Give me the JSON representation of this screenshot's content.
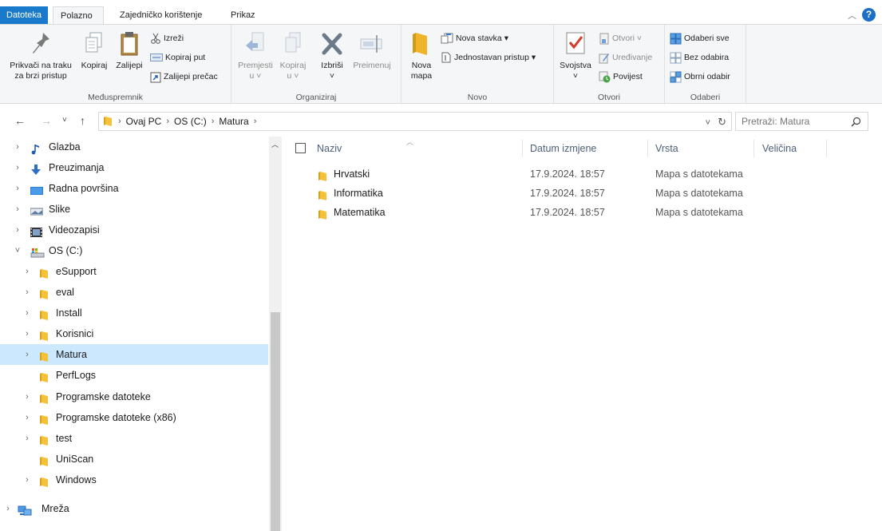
{
  "tabs": {
    "file": "Datoteka",
    "home": "Polazno",
    "share": "Zajedničko korištenje",
    "view": "Prikaz"
  },
  "ribbon": {
    "clipboard": {
      "label": "Međuspremnik",
      "pin_line1": "Prikvači na traku",
      "pin_line2": "za brzi pristup",
      "copy": "Kopiraj",
      "paste": "Zalijepi",
      "cut": "Izreži",
      "copy_path": "Kopiraj put",
      "paste_shortcut": "Zalijepi prečac"
    },
    "organize": {
      "label": "Organiziraj",
      "move_line1": "Premjesti",
      "move_line2": "u",
      "copy_line1": "Kopiraj",
      "copy_line2": "u",
      "delete": "Izbriši",
      "rename": "Preimenuj"
    },
    "new": {
      "label": "Novo",
      "new_folder_line1": "Nova",
      "new_folder_line2": "mapa",
      "new_item": "Nova stavka",
      "easy_access": "Jednostavan pristup"
    },
    "open": {
      "label": "Otvori",
      "properties": "Svojstva",
      "open": "Otvori",
      "edit": "Uređivanje",
      "history": "Povijest"
    },
    "select": {
      "label": "Odaberi",
      "select_all": "Odaberi sve",
      "select_none": "Bez odabira",
      "invert": "Obrni odabir"
    }
  },
  "address": {
    "crumbs": [
      "Ovaj PC",
      "OS (C:)",
      "Matura"
    ],
    "search_placeholder": "Pretraži: Matura"
  },
  "nav": {
    "items": [
      {
        "label": "Glazba",
        "icon": "music-icon",
        "level": 0,
        "expander": "›"
      },
      {
        "label": "Preuzimanja",
        "icon": "download-icon",
        "level": 0,
        "expander": "›"
      },
      {
        "label": "Radna površina",
        "icon": "desktop-icon",
        "level": 0,
        "expander": "›"
      },
      {
        "label": "Slike",
        "icon": "pictures-icon",
        "level": 0,
        "expander": "›"
      },
      {
        "label": "Videozapisi",
        "icon": "videos-icon",
        "level": 0,
        "expander": "›"
      },
      {
        "label": "OS (C:)",
        "icon": "drive-icon",
        "level": 0,
        "expander": "˅"
      },
      {
        "label": "eSupport",
        "icon": "folder-icon",
        "level": 1,
        "expander": "›"
      },
      {
        "label": "eval",
        "icon": "folder-icon",
        "level": 1,
        "expander": "›"
      },
      {
        "label": "Install",
        "icon": "folder-icon",
        "level": 1,
        "expander": "›"
      },
      {
        "label": "Korisnici",
        "icon": "folder-icon",
        "level": 1,
        "expander": "›"
      },
      {
        "label": "Matura",
        "icon": "folder-icon",
        "level": 1,
        "expander": "›",
        "selected": true
      },
      {
        "label": "PerfLogs",
        "icon": "folder-icon",
        "level": 1,
        "expander": ""
      },
      {
        "label": "Programske datoteke",
        "icon": "folder-icon",
        "level": 1,
        "expander": "›"
      },
      {
        "label": "Programske datoteke (x86)",
        "icon": "folder-icon",
        "level": 1,
        "expander": "›"
      },
      {
        "label": "test",
        "icon": "folder-icon",
        "level": 1,
        "expander": "›"
      },
      {
        "label": "UniScan",
        "icon": "folder-icon",
        "level": 1,
        "expander": ""
      },
      {
        "label": "Windows",
        "icon": "folder-icon",
        "level": 1,
        "expander": "›"
      },
      {
        "label": "Mreža",
        "icon": "network-icon",
        "level": -1,
        "expander": "›"
      }
    ]
  },
  "files": {
    "columns": {
      "name": "Naziv",
      "date": "Datum izmjene",
      "type": "Vrsta",
      "size": "Veličina"
    },
    "rows": [
      {
        "name": "Hrvatski",
        "date": "17.9.2024. 18:57",
        "type": "Mapa s datotekama"
      },
      {
        "name": "Informatika",
        "date": "17.9.2024. 18:57",
        "type": "Mapa s datotekama"
      },
      {
        "name": "Matematika",
        "date": "17.9.2024. 18:57",
        "type": "Mapa s datotekama"
      }
    ]
  },
  "colors": {
    "accent": "#1979ca",
    "selection": "#cce8ff",
    "folder": "#f7c948"
  }
}
